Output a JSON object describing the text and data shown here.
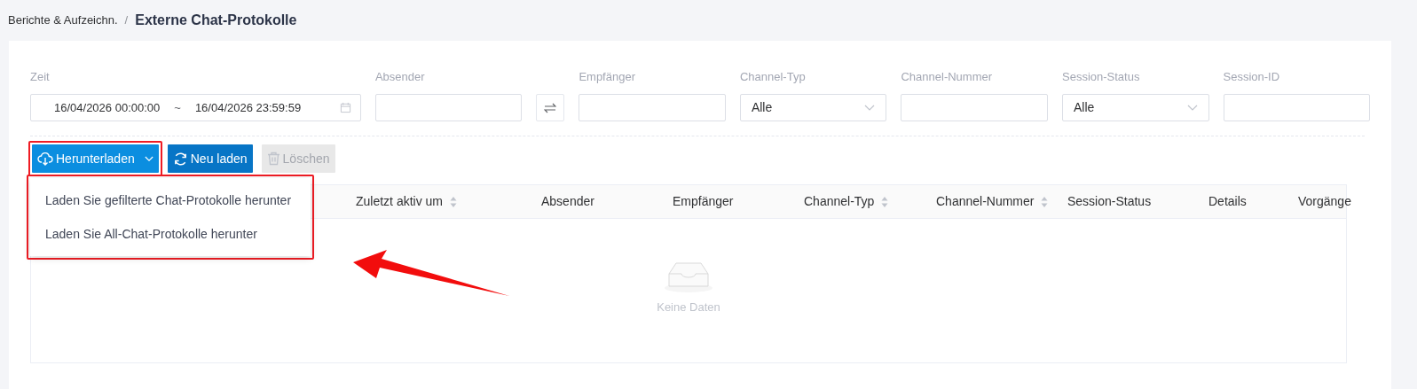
{
  "breadcrumb": {
    "parent": "Berichte & Aufzeichn.",
    "separator": "/",
    "current": "Externe Chat-Protokolle"
  },
  "filters": [
    {
      "label": "Zeit",
      "kind": "daterange",
      "start": "16/04/2026 00:00:00",
      "separator": "~",
      "end": "16/04/2026 23:59:59"
    },
    {
      "label": "Absender",
      "kind": "text"
    },
    {
      "kind": "swap"
    },
    {
      "label": "Empfänger",
      "kind": "text"
    },
    {
      "label": "Channel-Typ",
      "kind": "select",
      "value": "Alle"
    },
    {
      "label": "Channel-Nummer",
      "kind": "text"
    },
    {
      "label": "Session-Status",
      "kind": "select",
      "value": "Alle"
    },
    {
      "label": "Session-ID",
      "kind": "text"
    }
  ],
  "toolbar": [
    {
      "label": "Herunterladen",
      "kind": "download",
      "disabled": false,
      "highlighted": true
    },
    {
      "label": "Neu laden",
      "kind": "reload",
      "disabled": false,
      "highlighted": false
    },
    {
      "label": "Löschen",
      "kind": "delete",
      "disabled": true,
      "highlighted": false
    }
  ],
  "download_menu": {
    "highlighted": true,
    "items": [
      "Laden Sie gefilterte Chat-Protokolle herunter",
      "Laden Sie All-Chat-Protokolle herunter"
    ]
  },
  "table": {
    "columns": [
      {
        "label": "Zuletzt aktiv um",
        "sortable": true
      },
      {
        "label": "Absender",
        "sortable": false
      },
      {
        "label": "Empfänger",
        "sortable": false
      },
      {
        "label": "Channel-Typ",
        "sortable": true
      },
      {
        "label": "Channel-Nummer",
        "sortable": true
      },
      {
        "label": "Session-Status",
        "sortable": false
      },
      {
        "label": "Details",
        "sortable": false
      },
      {
        "label": "Vorgänge",
        "sortable": false
      }
    ],
    "empty_text": "Keine Daten"
  },
  "annotation_arrow": true
}
